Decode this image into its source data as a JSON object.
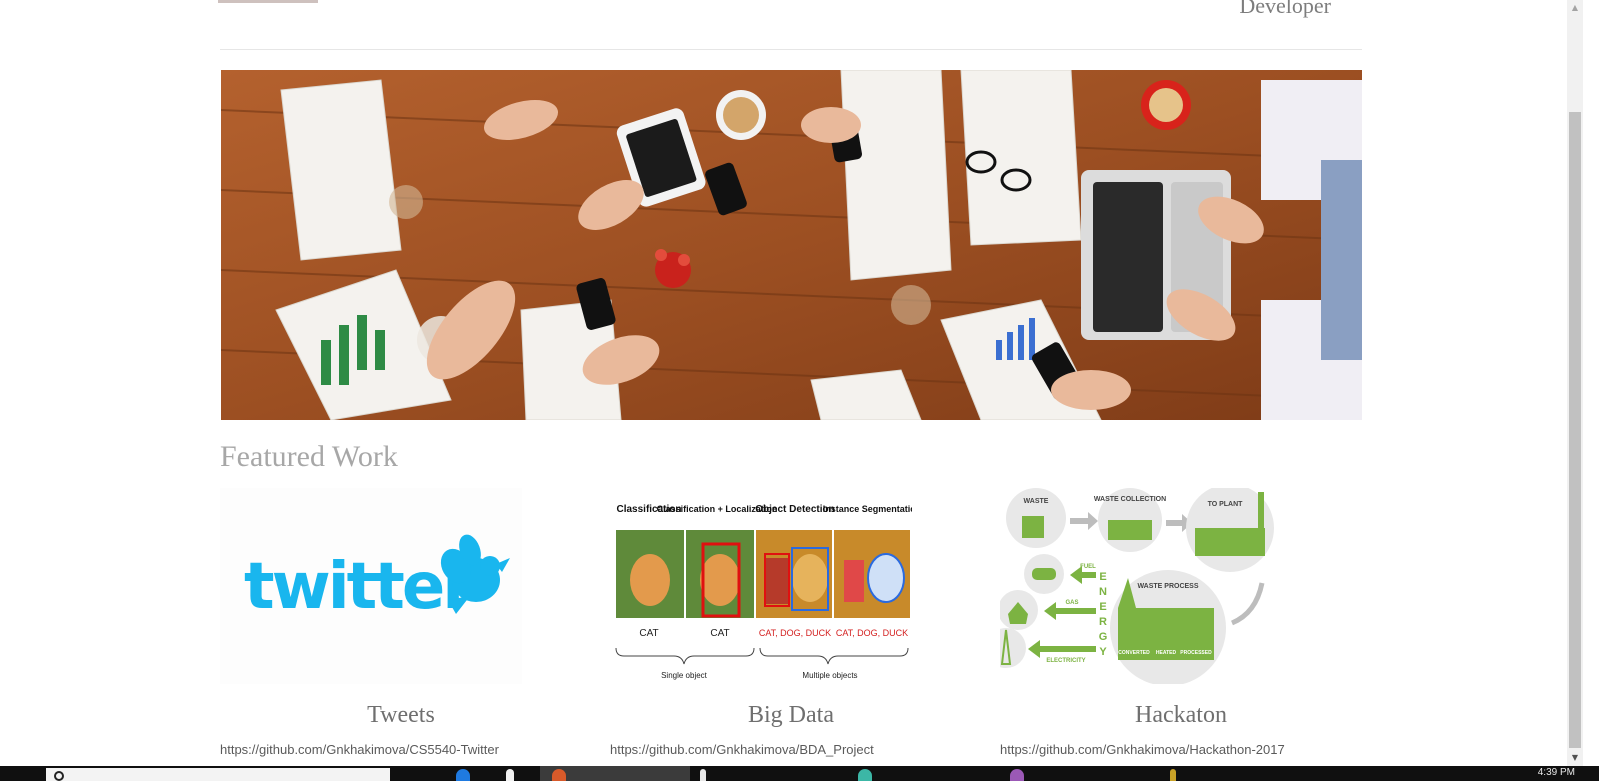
{
  "header": {
    "role_text": "Developer"
  },
  "featured": {
    "title": "Featured Work",
    "projects": [
      {
        "title": "Tweets",
        "link": "https://github.com/Gnkhakimova/CS5540-Twitter",
        "logo_text": "twitter"
      },
      {
        "title": "Big Data",
        "link": "https://github.com/Gnkhakimova/BDA_Project",
        "diagram": {
          "columns": [
            "Classification",
            "Classification + Localization",
            "Object Detection",
            "Instance Segmentation"
          ],
          "captions": [
            "CAT",
            "CAT",
            "CAT, DOG, DUCK",
            "CAT, DOG, DUCK"
          ],
          "brackets": [
            "Single object",
            "Multiple objects"
          ]
        }
      },
      {
        "title": "Hackaton",
        "link": "https://github.com/Gnkhakimova/Hackathon-2017",
        "diagram": {
          "nodes": [
            "WASTE",
            "WASTE COLLECTION",
            "TO PLANT",
            "WASTE PROCESS"
          ],
          "outputs": [
            "FUEL",
            "GAS",
            "ELECTRICITY"
          ],
          "energy_letters": "ENERGY",
          "process_steps": [
            "CONVERTED",
            "HEATED",
            "PROCESSED"
          ]
        }
      }
    ]
  },
  "taskbar": {
    "clock": "4:39 PM"
  },
  "colors": {
    "twitter_blue": "#1da1f2",
    "hack_green": "#7cb342",
    "wood": "#a0522d"
  }
}
